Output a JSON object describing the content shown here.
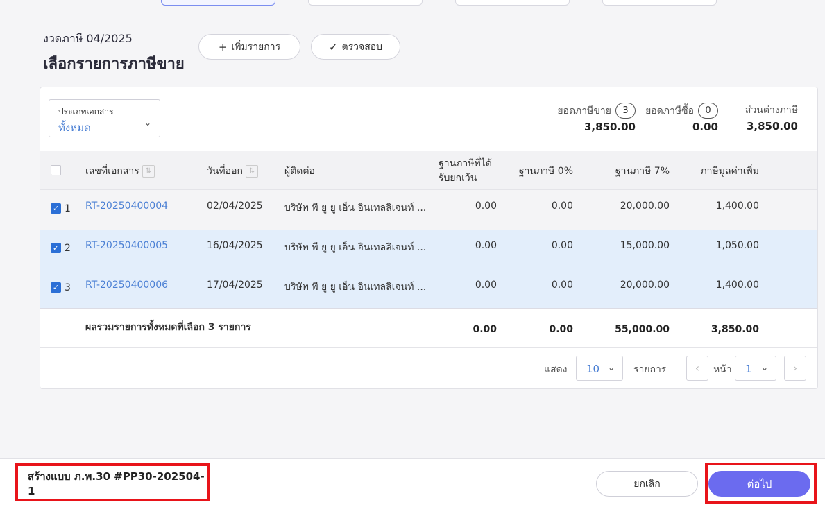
{
  "header": {
    "period": "งวดภาษี 04/2025",
    "title": "เลือกรายการภาษีขาย",
    "add_button": "เพิ่มรายการ",
    "check_button": "ตรวจสอบ"
  },
  "filter": {
    "label": "ประเภทเอกสาร",
    "value": "ทั้งหมด"
  },
  "summary": {
    "sales_tax_label": "ยอดภาษีขาย",
    "sales_tax_count": "3",
    "sales_tax_value": "3,850.00",
    "purchase_tax_label": "ยอดภาษีซื้อ",
    "purchase_tax_count": "0",
    "purchase_tax_value": "0.00",
    "diff_label": "ส่วนต่างภาษี",
    "diff_value": "3,850.00"
  },
  "table": {
    "columns": {
      "doc_no": "เลขที่เอกสาร",
      "date": "วันที่ออก",
      "contact": "ผู้ติดต่อ",
      "exempt_line1": "ฐานภาษีที่ได้",
      "exempt_line2": "รับยกเว้น",
      "zero": "ฐานภาษี 0%",
      "seven": "ฐานภาษี 7%",
      "vat": "ภาษีมูลค่าเพิ่ม"
    },
    "rows": [
      {
        "num": "1",
        "doc_no": "RT-20250400004",
        "date": "02/04/2025",
        "contact": "บริษัท พี ยู ยู เอ็น อินเทลลิเจนท์ ...",
        "exempt": "0.00",
        "zero": "0.00",
        "seven": "20,000.00",
        "vat": "1,400.00"
      },
      {
        "num": "2",
        "doc_no": "RT-20250400005",
        "date": "16/04/2025",
        "contact": "บริษัท พี ยู ยู เอ็น อินเทลลิเจนท์ ...",
        "exempt": "0.00",
        "zero": "0.00",
        "seven": "15,000.00",
        "vat": "1,050.00"
      },
      {
        "num": "3",
        "doc_no": "RT-20250400006",
        "date": "17/04/2025",
        "contact": "บริษัท พี ยู ยู เอ็น อินเทลลิเจนท์ ...",
        "exempt": "0.00",
        "zero": "0.00",
        "seven": "20,000.00",
        "vat": "1,400.00"
      }
    ],
    "totals": {
      "label": "ผลรวมรายการทั้งหมดที่เลือก 3 รายการ",
      "exempt": "0.00",
      "zero": "0.00",
      "seven": "55,000.00",
      "vat": "3,850.00"
    }
  },
  "pager": {
    "show_label": "แสดง",
    "page_size": "10",
    "items_label": "รายการ",
    "page_label": "หน้า",
    "page": "1"
  },
  "footer": {
    "form_title": "สร้างแบบ ภ.พ.30 #PP30-202504-1",
    "cancel": "ยกเลิก",
    "next": "ต่อไป"
  },
  "colors": {
    "primary": "#6b6bef",
    "link": "#4a7fd4",
    "selected_row": "#e3eefb",
    "highlight_border": "#e8141a"
  }
}
